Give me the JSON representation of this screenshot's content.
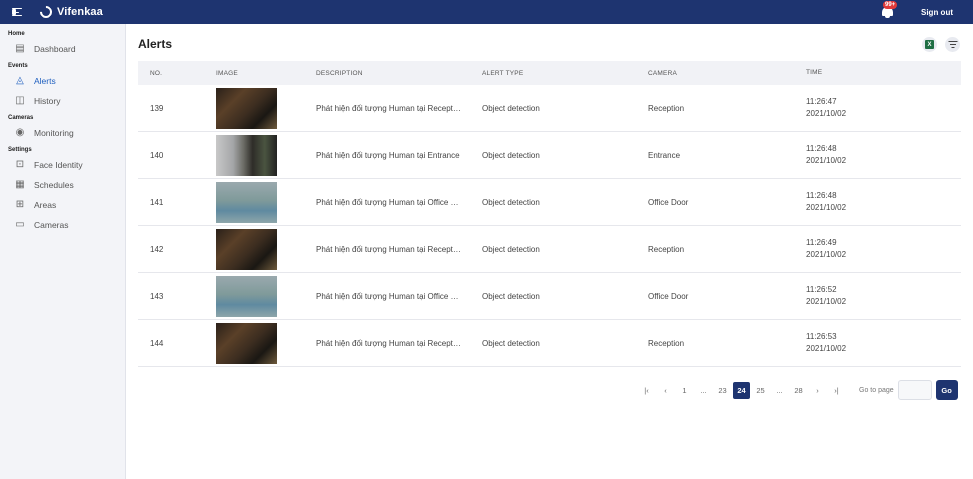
{
  "app": {
    "name": "Vifenkaa"
  },
  "header": {
    "notification_count": "99+",
    "signout_label": "Sign out"
  },
  "sidebar": {
    "sections": [
      {
        "label": "Home",
        "items": [
          {
            "label": "Dashboard",
            "icon": "dashboard-icon",
            "active": false
          }
        ]
      },
      {
        "label": "Events",
        "items": [
          {
            "label": "Alerts",
            "icon": "bell-icon",
            "active": true
          },
          {
            "label": "History",
            "icon": "history-icon",
            "active": false
          }
        ]
      },
      {
        "label": "Cameras",
        "items": [
          {
            "label": "Monitoring",
            "icon": "broadcast-icon",
            "active": false
          }
        ]
      },
      {
        "label": "Settings",
        "items": [
          {
            "label": "Face Identity",
            "icon": "face-scan-icon",
            "active": false
          },
          {
            "label": "Schedules",
            "icon": "calendar-icon",
            "active": false
          },
          {
            "label": "Areas",
            "icon": "area-icon",
            "active": false
          },
          {
            "label": "Cameras",
            "icon": "video-camera-icon",
            "active": false
          }
        ]
      }
    ]
  },
  "page": {
    "title": "Alerts"
  },
  "table": {
    "headers": [
      "NO.",
      "IMAGE",
      "DESCRIPTION",
      "ALERT TYPE",
      "CAMERA",
      "TIME"
    ],
    "rows": [
      {
        "no": "139",
        "image": "thumb-dark",
        "description": "Phát hiện đối tượng Human tại Reception",
        "alert_type": "Object detection",
        "camera": "Reception",
        "time": "11:26:47",
        "date": "2021/10/02"
      },
      {
        "no": "140",
        "image": "thumb-entrance",
        "description": "Phát hiện đối tượng Human tại Entrance",
        "alert_type": "Object detection",
        "camera": "Entrance",
        "time": "11:26:48",
        "date": "2021/10/02"
      },
      {
        "no": "141",
        "image": "thumb-office",
        "description": "Phát hiện đối tượng Human tại Office Door",
        "alert_type": "Object detection",
        "camera": "Office Door",
        "time": "11:26:48",
        "date": "2021/10/02"
      },
      {
        "no": "142",
        "image": "thumb-dark",
        "description": "Phát hiện đối tượng Human tại Reception",
        "alert_type": "Object detection",
        "camera": "Reception",
        "time": "11:26:49",
        "date": "2021/10/02"
      },
      {
        "no": "143",
        "image": "thumb-office",
        "description": "Phát hiện đối tượng Human tại Office Door",
        "alert_type": "Object detection",
        "camera": "Office Door",
        "time": "11:26:52",
        "date": "2021/10/02"
      },
      {
        "no": "144",
        "image": "thumb-dark",
        "description": "Phát hiện đối tượng Human tại Reception",
        "alert_type": "Object detection",
        "camera": "Reception",
        "time": "11:26:53",
        "date": "2021/10/02"
      }
    ]
  },
  "pagination": {
    "first_icon": "first-page-icon",
    "prev_icon": "prev-page-icon",
    "next_icon": "next-page-icon",
    "last_icon": "last-page-icon",
    "pages": [
      "1",
      "...",
      "23",
      "24",
      "25",
      "...",
      "28"
    ],
    "current": "24",
    "goto_label": "Go to page",
    "go_label": "Go"
  },
  "colors": {
    "header_bg": "#1e3470",
    "active_nav": "#1f5fbf",
    "badge": "#e03a3a"
  }
}
